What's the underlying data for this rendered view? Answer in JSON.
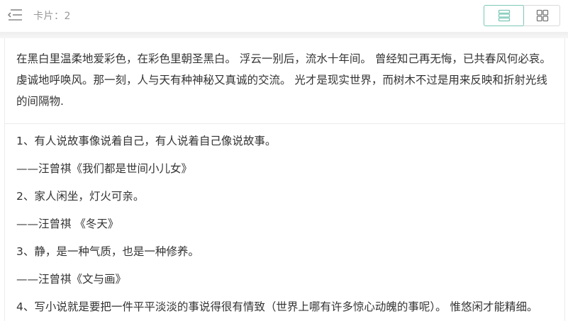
{
  "header": {
    "card_count_label": "卡片：2",
    "icons": {
      "menu": "menu-collapse-icon",
      "list_view": "list-view-icon",
      "grid_view": "grid-view-icon"
    },
    "accent_color": "#7cc8b8"
  },
  "card": {
    "intro": "在黑白里温柔地爱彩色，在彩色里朝圣黑白。 浮云一别后，流水十年间。 曾经知己再无悔，已共春风何必哀。 虔诚地呼唤风。那一刻，人与天有种神秘又真诚的交流。 光才是现实世界，而树木不过是用来反映和折射光线的间隔物.",
    "quotes": [
      "1、有人说故事像说着自己，有人说着自己像说故事。",
      "——汪曾祺《我们都是世间小儿女》",
      "2、家人闲坐，灯火可亲。",
      "——汪曾祺 《冬天》",
      "3、静，是一种气质，也是一种修养。",
      "——汪曾祺《文与画》",
      "4、写小说就是要把一件平平淡淡的事说得很有情致（世界上哪有许多惊心动魄的事呢）。 惟悠闲才能精细。"
    ]
  }
}
